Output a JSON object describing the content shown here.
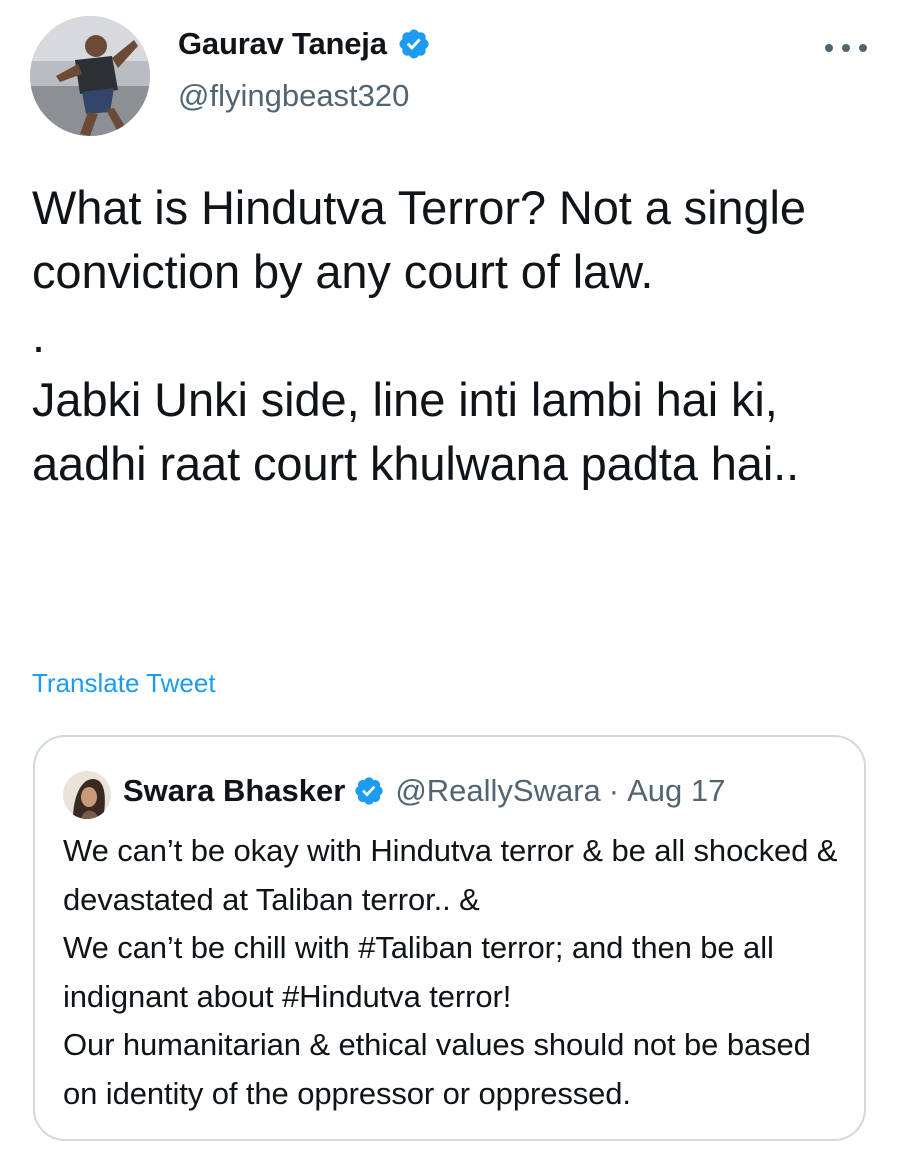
{
  "author": {
    "name": "Gaurav Taneja",
    "handle": "@flyingbeast320",
    "verified": true,
    "avatar_icon": "profile-photo"
  },
  "more_icon": "more-horizontal-icon",
  "tweet": {
    "paragraphs": [
      "What is Hindutva Terror? Not a single conviction by any court of law.",
      ".",
      "Jabki Unki side, line inti lambi hai ki, aadhi raat court khulwana padta hai.."
    ],
    "translate_label": "Translate Tweet"
  },
  "quoted_tweet": {
    "name": "Swara Bhasker",
    "verified": true,
    "handle": "@ReallySwara",
    "separator": "·",
    "date": "Aug 17",
    "text": "We can’t be okay with Hindutva terror & be all shocked & devastated at Taliban terror.. &\nWe can’t be chill with #Taliban terror; and then be all indignant about #Hindutva terror!\nOur humanitarian & ethical values should not be based on identity of the oppressor or oppressed."
  },
  "colors": {
    "text": "#0f1419",
    "secondary": "#536471",
    "link": "#1d9bf0",
    "verified": "#1d9bf0",
    "border": "#cfd9de"
  }
}
